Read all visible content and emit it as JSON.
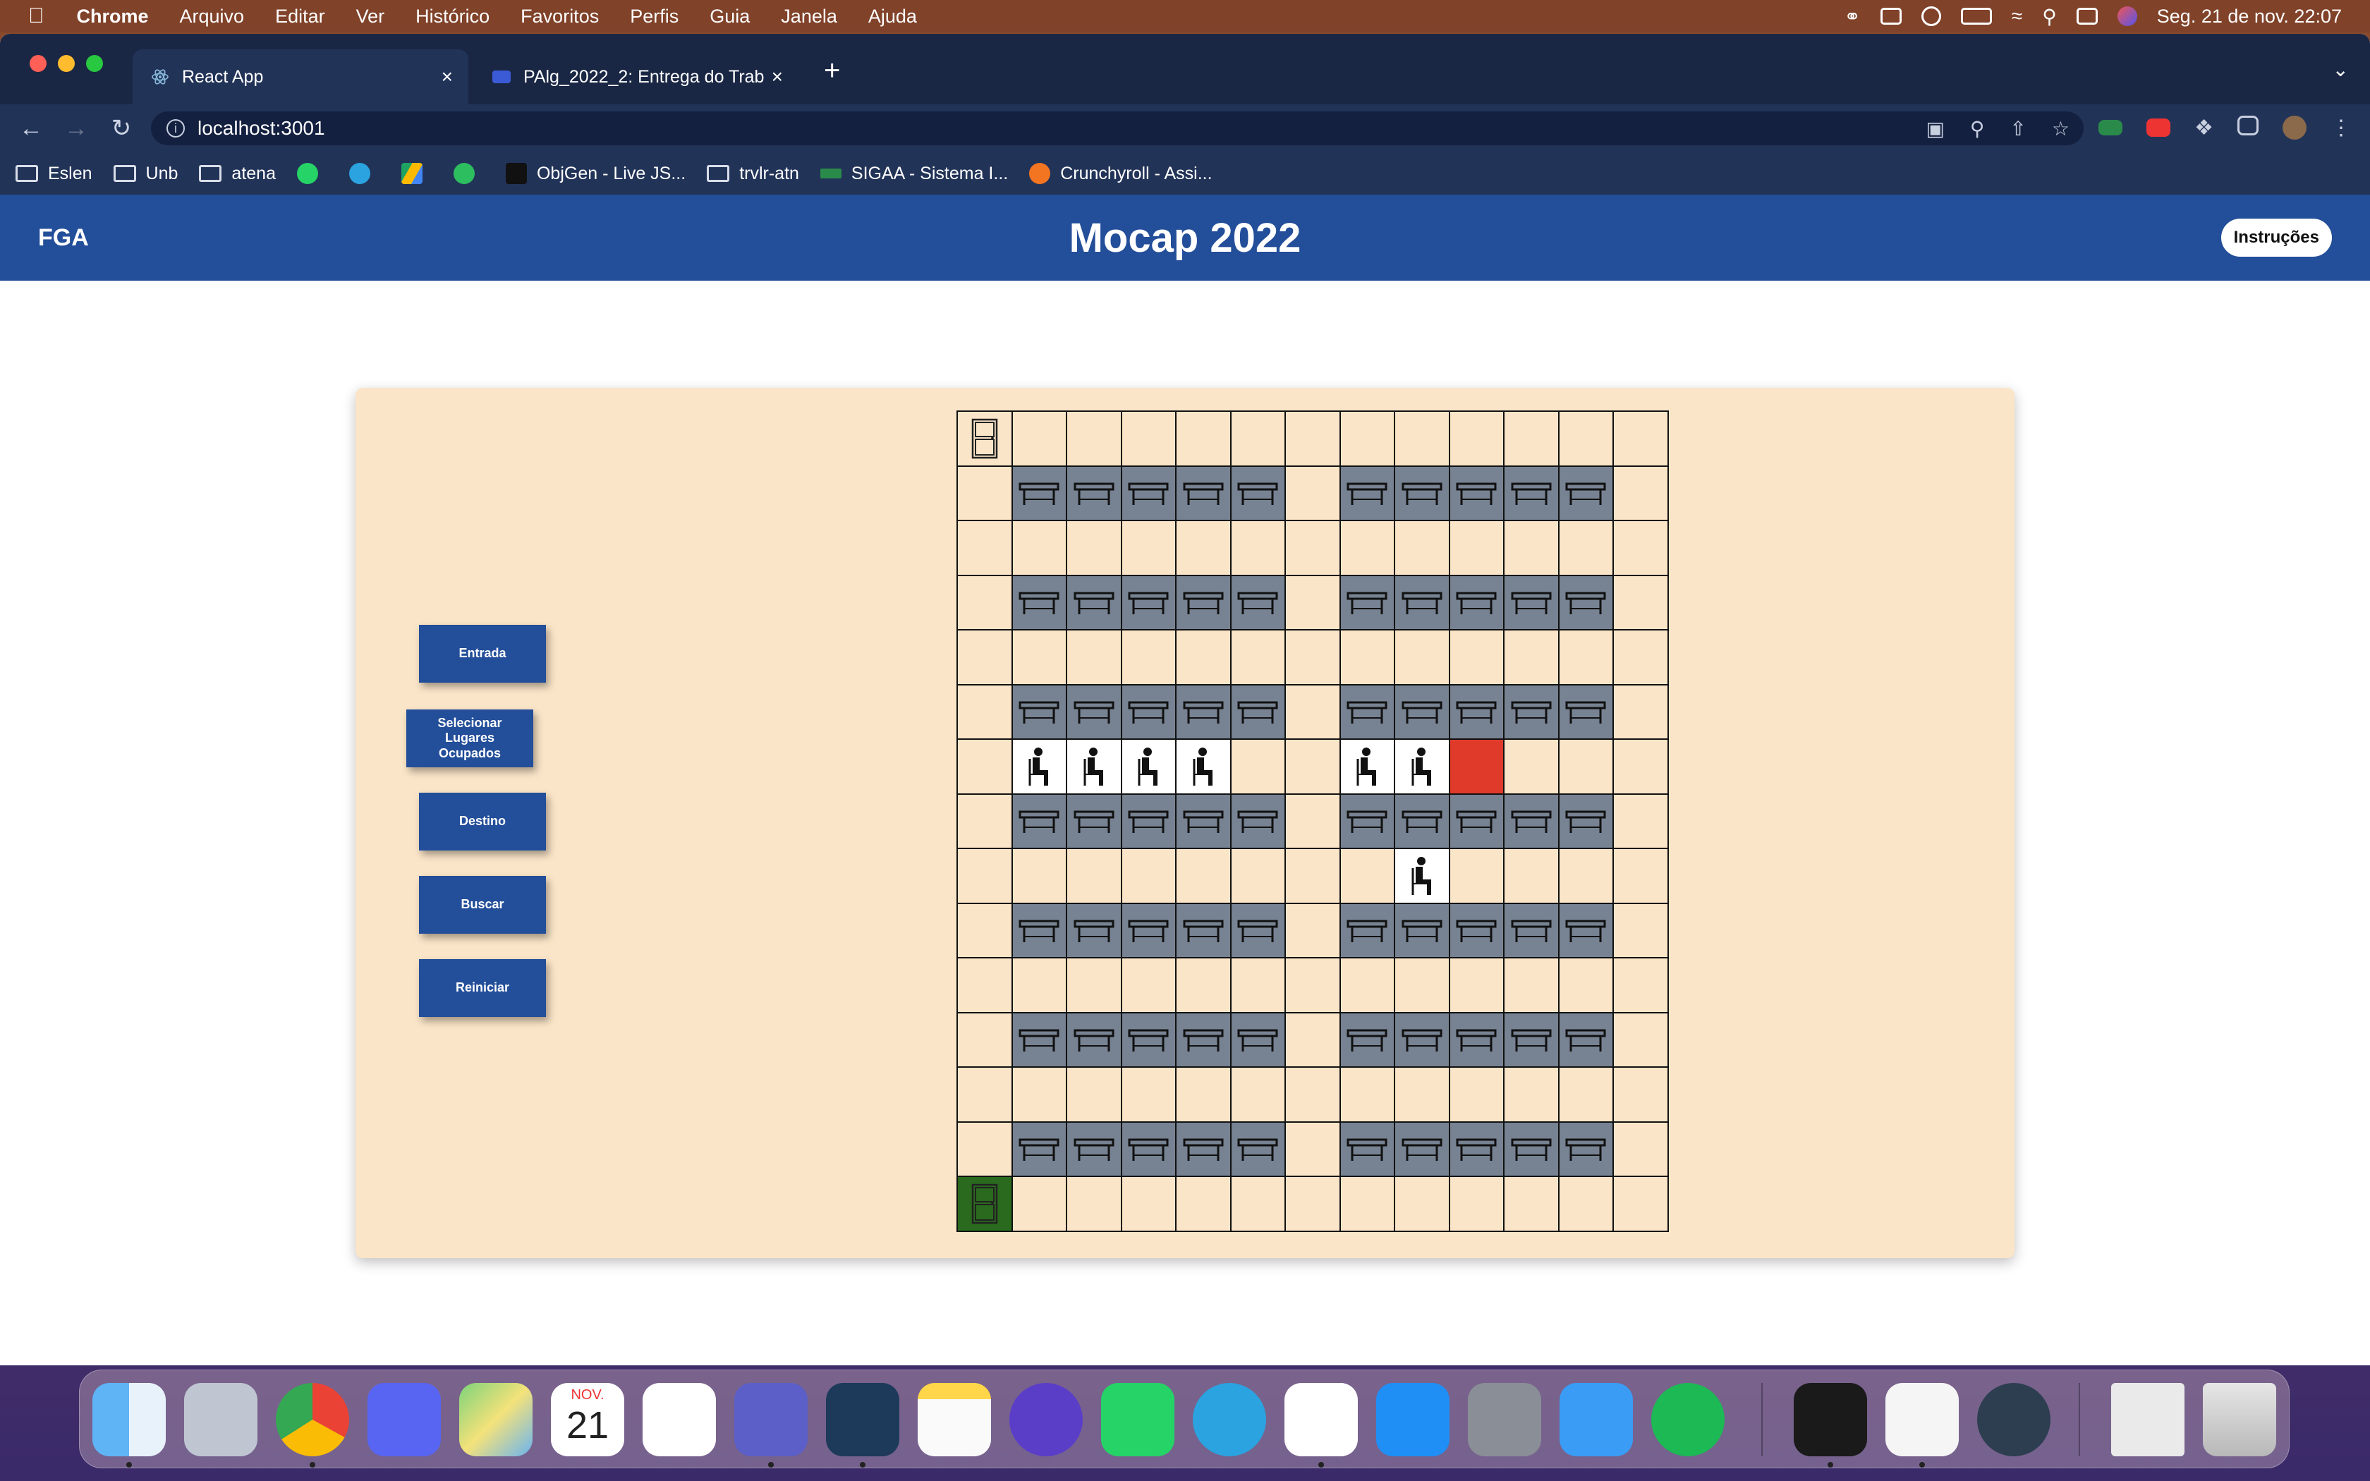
{
  "menubar": {
    "app": "Chrome",
    "items": [
      "Arquivo",
      "Editar",
      "Ver",
      "Histórico",
      "Favoritos",
      "Perfis",
      "Guia",
      "Janela",
      "Ajuda"
    ],
    "datetime": "Seg. 21 de nov.  22:07"
  },
  "browser": {
    "tabs": [
      {
        "title": "React App"
      },
      {
        "title": "PAlg_2022_2: Entrega do Trab"
      }
    ],
    "url": "localhost:3001",
    "bookmarks": [
      "Eslen",
      "Unb",
      "atena",
      "ObjGen - Live JS...",
      "trvlr-atn",
      "SIGAA - Sistema I...",
      "Crunchyroll - Assi..."
    ]
  },
  "app": {
    "brand": "FGA",
    "title": "Mocap 2022",
    "instructions_label": "Instruções",
    "controls": {
      "entrada": "Entrada",
      "selecionar": "Selecionar Lugares Ocupados",
      "destino": "Destino",
      "buscar": "Buscar",
      "reiniciar": "Reiniciar"
    },
    "grid": {
      "cols": 13,
      "rows": [
        "D............",
        ".TTTTT.TTTTT.",
        ".............",
        ".TTTTT.TTTTT.",
        ".............",
        ".TTTTT.TTTTT.",
        ".PPPP..PPR...",
        ".TTTTT.TTTTT.",
        "........P....",
        ".TTTTT.TTTTT.",
        ".............",
        ".TTTTT.TTTTT.",
        ".............",
        ".TTTTT.TTTTT.",
        "E............"
      ],
      "legend": {
        "D": "door",
        "T": "desk",
        "P": "occupied-seat",
        "R": "destination",
        "E": "entrance-door",
        ".": "empty"
      }
    }
  },
  "dock": {
    "calendar_month": "NOV.",
    "calendar_day": "21"
  },
  "colors": {
    "header": "#234e99",
    "panel": "#fae5c8",
    "desk": "#778393",
    "destination": "#e03a2a",
    "entrance": "#2a6a1e"
  }
}
